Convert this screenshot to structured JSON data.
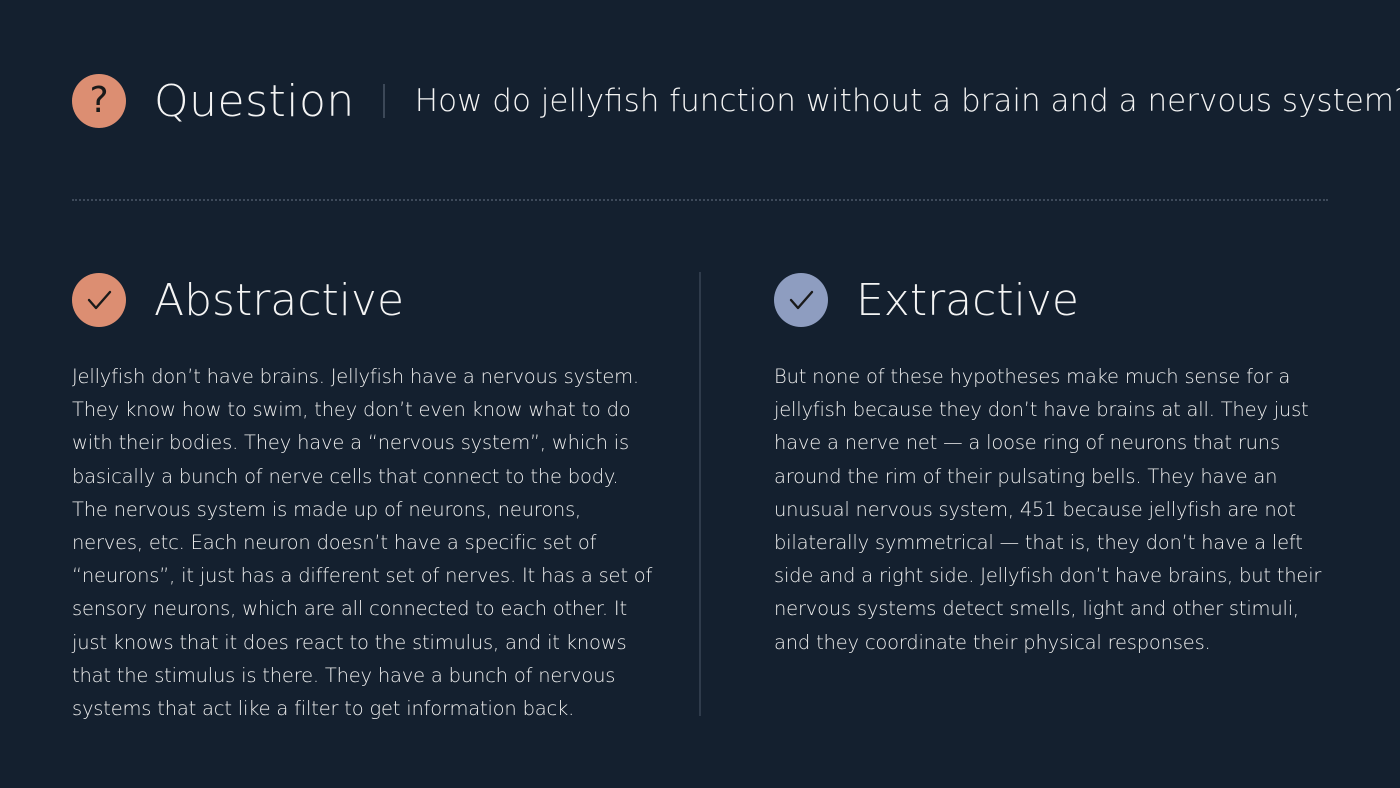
{
  "header": {
    "icon": "question-mark-icon",
    "label": "Question",
    "question": "How do jellyfish function without a brain and a nervous system?"
  },
  "colors": {
    "background": "#14202f",
    "accent_orange": "#dc8e72",
    "accent_blue": "#8e9dc0"
  },
  "abstractive": {
    "icon": "checkmark-icon",
    "title": "Abstractive",
    "lines": [
      "Jellyfish don’t have brains. Jellyfish have a nervous system.",
      "They know how to swim, they don’t even know what to do",
      "with their bodies. They have a “nervous system”, which is",
      "basically a bunch of nerve cells that connect to the body.",
      "The nervous system is made up of neurons, neurons,",
      "nerves, etc. Each neuron doesn’t have a specific set of",
      "“neurons”, it just has a different set of nerves. It has a set of",
      "sensory neurons, which are all connected to each other. It",
      "just knows that it does react to the stimulus, and it knows",
      "that the stimulus is there. They have a bunch of nervous",
      "systems that act like a filter to get information back."
    ]
  },
  "extractive": {
    "icon": "checkmark-icon",
    "title": "Extractive",
    "lines": [
      "But none of these hypotheses make much sense for a",
      "jellyfish because they don’t have brains at all. They just",
      "have a nerve net — a loose ring of neurons that runs",
      "around the rim of their pulsating bells. They have an",
      "unusual nervous system, 451 because jellyfish are not",
      "bilaterally symmetrical — that is, they don’t have a left",
      "side and a right side. Jellyfish don’t have brains, but their",
      "nervous systems detect smells, light and other stimuli,",
      "and they coordinate their physical responses."
    ]
  }
}
